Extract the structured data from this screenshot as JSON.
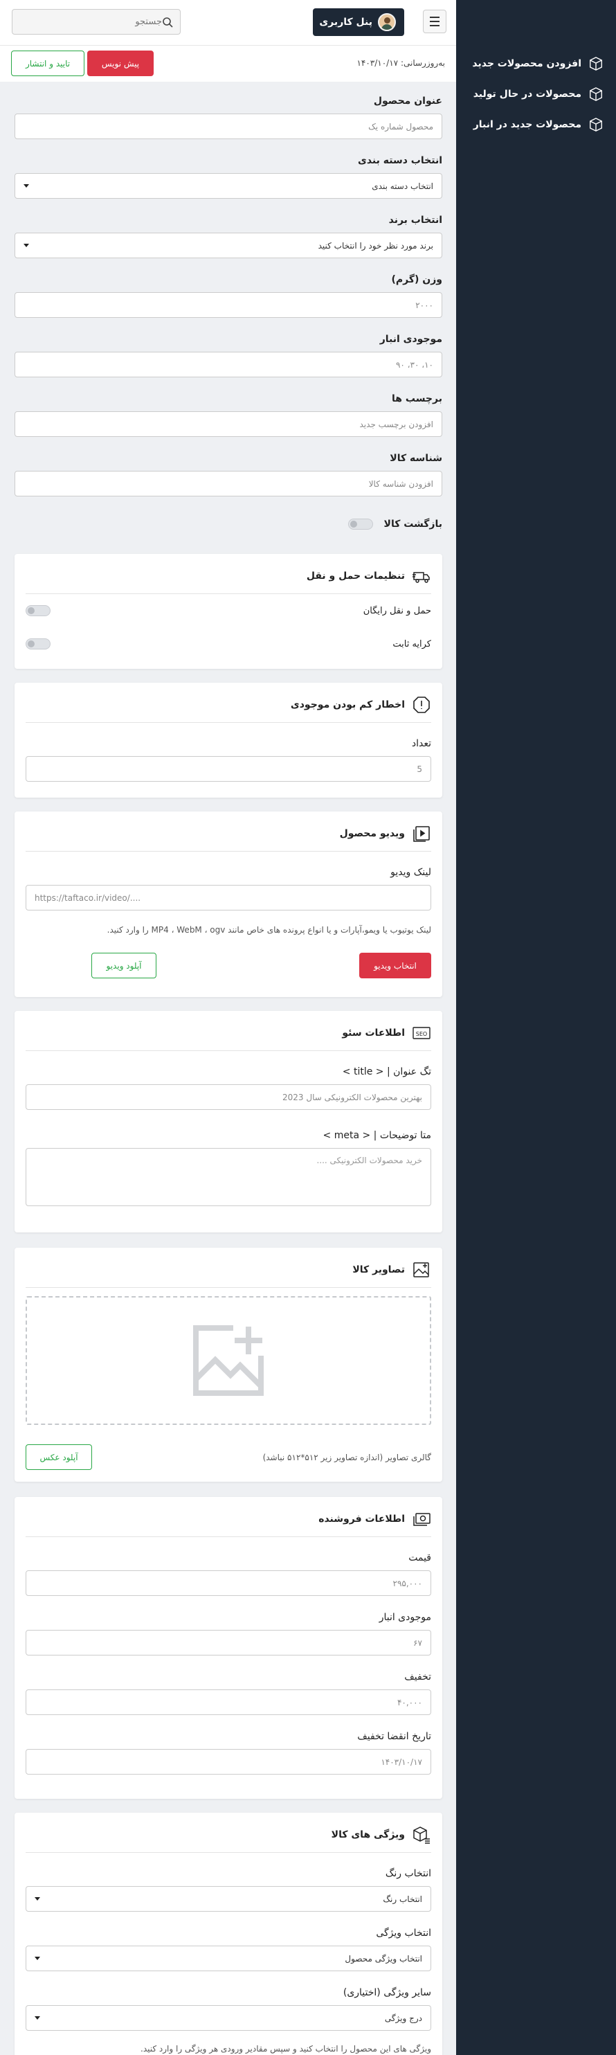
{
  "header": {
    "panel_label": "پنل کاربری",
    "search_placeholder": "جستجو"
  },
  "sidebar": {
    "items": [
      {
        "label": "افزودن محصولات جدید"
      },
      {
        "label": "محصولات در حال تولید"
      },
      {
        "label": "محصولات جدید در انبار"
      }
    ]
  },
  "actionbar": {
    "updated": "به‌روزرسانی: ۱۴۰۳/۱۰/۱۷",
    "draft_label": "پیش نویس",
    "publish_label": "تایید و انتشار"
  },
  "form": {
    "title_label": "عنوان محصول",
    "title_placeholder": "محصول شماره یک",
    "category_label": "انتخاب دسته بندی",
    "category_value": "انتخاب دسته بندی",
    "brand_label": "انتخاب برند",
    "brand_value": "برند مورد نظر خود را انتخاب کنید",
    "weight_label": "وزن (گرم)",
    "weight_placeholder": "۲۰۰۰",
    "stock_label": "موجودی انبار",
    "stock_placeholder": "۱۰، ۳۰، ۹۰",
    "tags_label": "برچسب ها",
    "tags_placeholder": "افزودن برچسب جدید",
    "sku_label": "شناسه کالا",
    "sku_placeholder": "افزودن شناسه کالا",
    "return_label": "بازگشت کالا"
  },
  "shipping": {
    "title": "تنظیمات حمل و نقل",
    "free_label": "حمل و نقل رایگان",
    "fixed_label": "کرایه ثابت"
  },
  "low_stock": {
    "title": "اخطار کم بودن موجودی",
    "count_label": "تعداد",
    "count_placeholder": "5"
  },
  "video": {
    "title": "ویدیو محصول",
    "link_label": "لینک ویدیو",
    "link_placeholder": "https://taftaco.ir/video/....",
    "help": "لینک یوتیوب یا ویمو،آپارات و یا انواع پرونده های خاص مانند MP4 ، WebM ، ogv را وارد کنید.",
    "upload_label": "آپلود ویدیو",
    "choose_label": "انتخاب ویدیو"
  },
  "seo": {
    "title": "اطلاعات سئو",
    "title_tag_label": "تگ عنوان | < title >",
    "title_tag_placeholder": "بهترین محصولات الکترونیکی سال 2023",
    "meta_label": "متا توضیحات | < meta >",
    "meta_placeholder": "خرید محصولات الکترونیکی ...."
  },
  "images": {
    "title": "تصاویر کالا",
    "help": "گالری تصاویر (اندازه تصاویر زیر ۵۱۲*۵۱۲ نباشد)",
    "upload_label": "آپلود عکس"
  },
  "seller": {
    "title": "اطلاعات فروشنده",
    "price_label": "قیمت",
    "price_placeholder": "۲۹۵,۰۰۰",
    "stock_label": "موجودی انبار",
    "stock_placeholder": "۶۷",
    "discount_label": "تخفیف",
    "discount_placeholder": "۴۰,۰۰۰",
    "expiry_label": "تاریخ انقضا تخفیف",
    "expiry_placeholder": "۱۴۰۳/۱۰/۱۷"
  },
  "features": {
    "title": "ویژگی های کالا",
    "color_label": "انتخاب رنگ",
    "color_value": "انتخاب رنگ",
    "feature_label": "انتخاب ویژگی",
    "feature_value": "انتخاب ویژگی محصول",
    "other_label": "سایر ویژگی (اختیاری)",
    "other_value": "درج ویژگی",
    "help": "ویژگی های این محصول را انتخاب کنید و سپس مقادیر ورودی هر ویژگی را وارد کنید."
  },
  "colors": {
    "sidebar": "#1d2836",
    "danger": "#dc3545",
    "success": "#28a745"
  }
}
